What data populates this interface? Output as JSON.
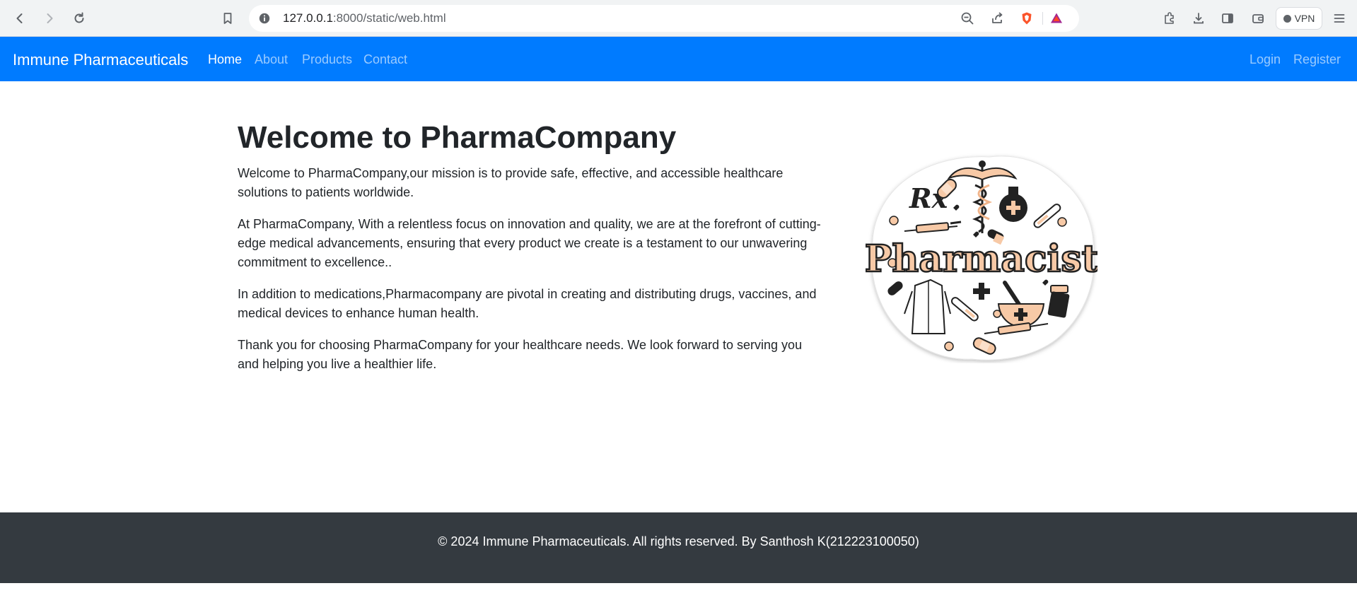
{
  "browser": {
    "url_host": "127.0.0.1",
    "url_rest": ":8000/static/web.html",
    "vpn_label": "VPN",
    "icons": [
      "back-icon",
      "forward-icon",
      "reload-icon",
      "bookmark-icon",
      "site-info-icon",
      "zoom-out-icon",
      "share-icon",
      "brave-shield-icon",
      "brave-rewards-icon",
      "extensions-icon",
      "download-icon",
      "sidebar-icon",
      "wallet-icon",
      "menu-icon"
    ]
  },
  "navbar": {
    "brand": "Immune Pharmaceuticals",
    "links": [
      "Home",
      "About",
      "Products",
      "Contact"
    ],
    "right_links": [
      "Login",
      "Register"
    ],
    "accent": "#007bff"
  },
  "main": {
    "title": "Welcome to PharmaCompany",
    "paragraphs": [
      "Welcome to PharmaCompany,our mission is to provide safe, effective, and accessible healthcare solutions to patients worldwide.",
      "At PharmaCompany, With a relentless focus on innovation and quality, we are at the forefront of cutting-edge medical advancements, ensuring that every product we create is a testament to our unwavering commitment to excellence..",
      "In addition to medications,Pharmacompany are pivotal in creating and distributing drugs, vaccines, and medical devices to enhance human health.",
      "Thank you for choosing PharmaCompany for your healthcare needs. We look forward to serving you and helping you live a healthier life."
    ],
    "sticker": {
      "title": "Pharmacist",
      "rx": "Rx"
    }
  },
  "footer": {
    "text": "© 2024 Immune Pharmaceuticals. All rights reserved. By Santhosh K(212223100050)",
    "bg": "#343a40"
  }
}
